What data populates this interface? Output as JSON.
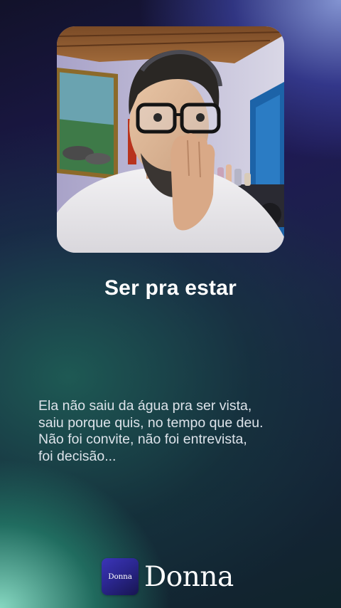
{
  "song": {
    "title": "Ser pra estar",
    "lyrics": [
      "Ela não saiu da água pra ser vista,",
      "saiu porque quis, no tempo que deu.",
      "Não foi convite, não foi entrevista,",
      "foi decisão..."
    ]
  },
  "cover_art": {
    "icon": "person-portrait-photo"
  },
  "brand": {
    "icon_label": "Donna",
    "name": "Donna",
    "accent_color": "#2f2aa0"
  }
}
